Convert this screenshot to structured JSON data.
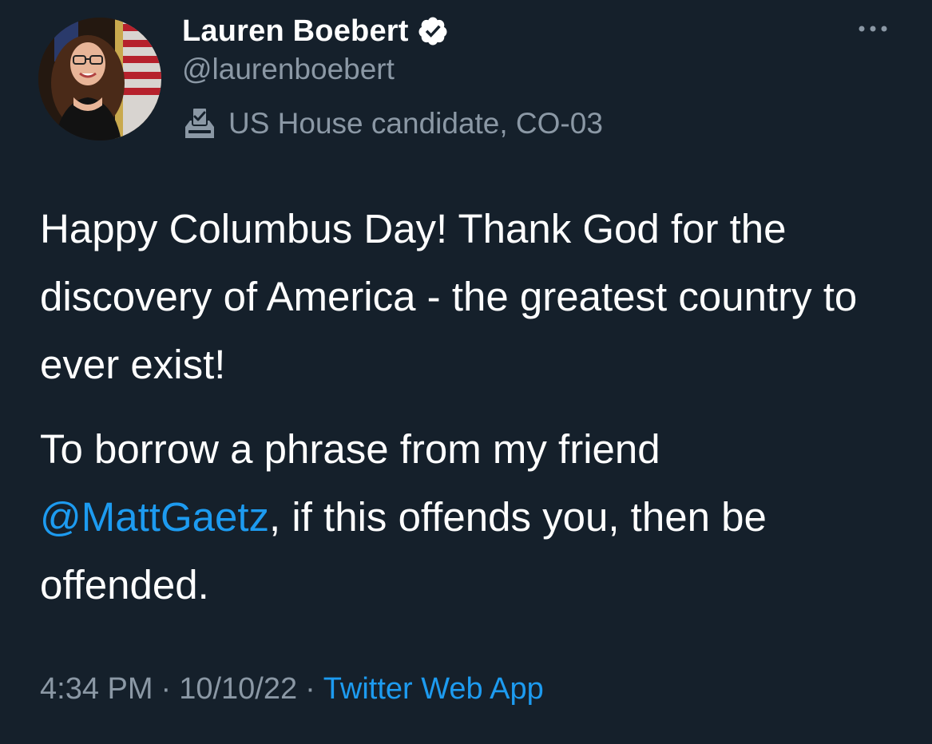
{
  "author": {
    "display_name": "Lauren Boebert",
    "handle": "@laurenboebert",
    "verified": true,
    "bio_label": "US House candidate, CO-03"
  },
  "tweet": {
    "paragraph1": "Happy Columbus Day! Thank God for the discovery of America - the greatest country to ever exist!",
    "paragraph2_before": "To borrow a phrase from my friend ",
    "mention": "@MattGaetz",
    "paragraph2_after": ", if this offends you, then be offended."
  },
  "meta": {
    "time": "4:34 PM",
    "separator": "·",
    "date": "10/10/22",
    "source": "Twitter Web App"
  },
  "colors": {
    "background": "#15202b",
    "text": "#ffffff",
    "secondary_text": "#8b98a5",
    "link": "#1d9bf0"
  },
  "icons": {
    "verified": "verified-badge-icon",
    "bio": "ballot-box-icon",
    "more": "more-options-icon"
  }
}
